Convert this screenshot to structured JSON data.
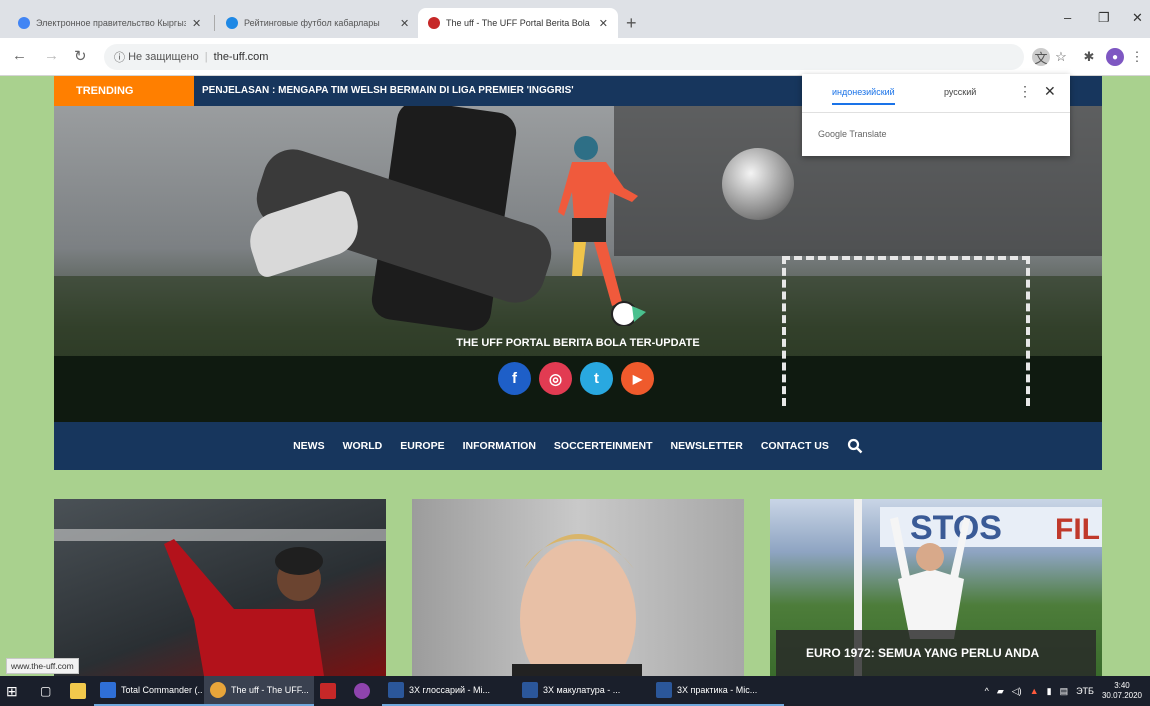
{
  "browser": {
    "tabs": [
      {
        "label": "Электронное правительство Кыргызской Республики",
        "favicon_color": "#4285f4"
      },
      {
        "label": "Рейтинговые футбол кабарлары",
        "favicon_color": "#1e88e5"
      },
      {
        "label": "The uff - The UFF Portal Berita Bola",
        "favicon_color": "#c62828"
      }
    ],
    "new_tab_symbol": "+",
    "window_controls": [
      "–",
      "❐",
      "✕"
    ],
    "security_text": "Не защищено",
    "url": "the-uff.com"
  },
  "translate_popup": {
    "lang_active": "индонезийский",
    "lang_other": "русский",
    "more_symbol": "⋮",
    "close_symbol": "✕",
    "footer": "Google Translate"
  },
  "site": {
    "trending_label": "TRENDING",
    "trending_headline": "PENJELASAN : MENGAPA TIM WELSH BERMAIN DI LIGA PREMIER 'INGGRIS'",
    "hero_title": "THE UFF PORTAL BERITA BOLA TER-UPDATE",
    "socials": [
      {
        "name": "facebook",
        "glyph": "f",
        "color": "#1e5fc8"
      },
      {
        "name": "instagram",
        "glyph": "◎",
        "color": "#e23b52"
      },
      {
        "name": "twitter",
        "glyph": "t",
        "color": "#29a8e0"
      },
      {
        "name": "youtube",
        "glyph": "▶",
        "color": "#ef5a2c"
      }
    ],
    "nav": [
      "NEWS",
      "WORLD",
      "EUROPE",
      "INFORMATION",
      "SOCCERTEINMENT",
      "NEWSLETTER",
      "CONTACT US"
    ],
    "cards": [
      {
        "caption": ""
      },
      {
        "caption": ""
      },
      {
        "caption": "EURO 1972: SEMUA YANG PERLU ANDA"
      }
    ]
  },
  "status_url": "www.the-uff.com",
  "taskbar": {
    "apps": [
      {
        "label": "Total Commander (..",
        "color": "#2f6fd6"
      },
      {
        "label": "The uff - The UFF...",
        "color": "#e8a53a"
      },
      {
        "label": "",
        "color": "#c62828"
      },
      {
        "label": "",
        "color": "#8e44ad"
      },
      {
        "label": "3Х глоссарий - Mi...",
        "color": "#2b579a"
      },
      {
        "label": "3Х макулатура - ...",
        "color": "#2b579a"
      },
      {
        "label": "3Х практика - Mic...",
        "color": "#2b579a"
      }
    ],
    "lang": "ЭТБ",
    "time": "3:40",
    "date": "30.07.2020"
  }
}
